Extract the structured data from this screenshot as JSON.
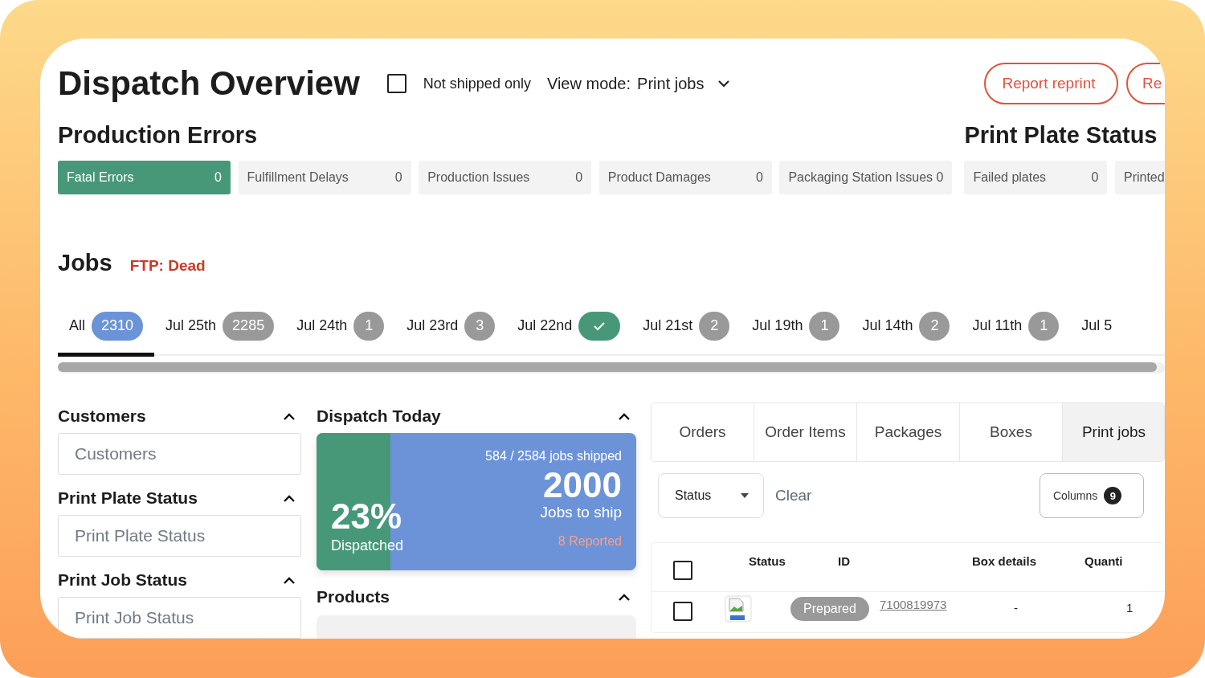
{
  "title": "Dispatch Overview",
  "not_shipped_only": {
    "label": "Not shipped only",
    "checked": false
  },
  "view_mode": {
    "label": "View mode:",
    "value": "Print jobs"
  },
  "buttons": [
    "Report reprint",
    "Re"
  ],
  "production_errors": {
    "title": "Production Errors",
    "items": [
      {
        "label": "Fatal Errors",
        "count": "0",
        "selected": true
      },
      {
        "label": "Fulfillment Delays",
        "count": "0",
        "selected": false
      },
      {
        "label": "Production Issues",
        "count": "0",
        "selected": false
      },
      {
        "label": "Product Damages",
        "count": "0",
        "selected": false
      },
      {
        "label": "Packaging Station Issues",
        "count": "0",
        "selected": false
      }
    ]
  },
  "print_plate_status": {
    "title": "Print Plate Status",
    "items": [
      {
        "label": "Failed plates",
        "count": "0",
        "selected": false
      },
      {
        "label": "Printed",
        "selected": false
      }
    ]
  },
  "jobs": {
    "title": "Jobs",
    "ftp_status": "FTP: Dead"
  },
  "date_tabs": [
    {
      "label": "All",
      "kind": "count",
      "badge": "2310",
      "selected": true
    },
    {
      "label": "Jul 25th",
      "kind": "count",
      "badge": "2285",
      "selected": false
    },
    {
      "label": "Jul 24th",
      "kind": "count",
      "badge": "1",
      "selected": false
    },
    {
      "label": "Jul 23rd",
      "kind": "count",
      "badge": "3",
      "selected": false
    },
    {
      "label": "Jul 22nd",
      "kind": "check",
      "selected": false
    },
    {
      "label": "Jul 21st",
      "kind": "count",
      "badge": "2",
      "selected": false
    },
    {
      "label": "Jul 19th",
      "kind": "count",
      "badge": "1",
      "selected": false
    },
    {
      "label": "Jul 14th",
      "kind": "count",
      "badge": "2",
      "selected": false
    },
    {
      "label": "Jul 11th",
      "kind": "count",
      "badge": "1",
      "selected": false
    },
    {
      "label": "Jul 5",
      "kind": "count",
      "selected": false
    }
  ],
  "filters": [
    {
      "title": "Customers",
      "placeholder": "Customers",
      "expanded": true
    },
    {
      "title": "Print Plate Status",
      "placeholder": "Print Plate Status",
      "expanded": true
    },
    {
      "title": "Print Job Status",
      "placeholder": "Print Job Status",
      "expanded": true
    }
  ],
  "dispatch_today": {
    "title": "Dispatch Today",
    "expanded": true,
    "level": 0.23,
    "percent": "23%",
    "percent_label": "Dispatched",
    "shipped": "584 / 2584 jobs shipped",
    "to_ship": "2000",
    "to_ship_label": "Jobs to ship",
    "reported": "8 Reported"
  },
  "products": {
    "title": "Products",
    "expanded": true
  },
  "view_tabs": [
    {
      "label": "Orders",
      "selected": false
    },
    {
      "label": "Order Items",
      "selected": false
    },
    {
      "label": "Packages",
      "selected": false
    },
    {
      "label": "Boxes",
      "selected": false
    },
    {
      "label": "Print jobs",
      "selected": true
    }
  ],
  "status_filter": "Status",
  "clear": "Clear",
  "columns_button": {
    "label": "Columns",
    "count": "9"
  },
  "table": {
    "select_all_checked": false,
    "columns": [
      "Status",
      "ID",
      "Box details",
      "Quanti"
    ],
    "rows": [
      {
        "checked": false,
        "status": "Prepared",
        "id": "7100819973",
        "box_details": "-",
        "quantity": "1"
      }
    ]
  }
}
